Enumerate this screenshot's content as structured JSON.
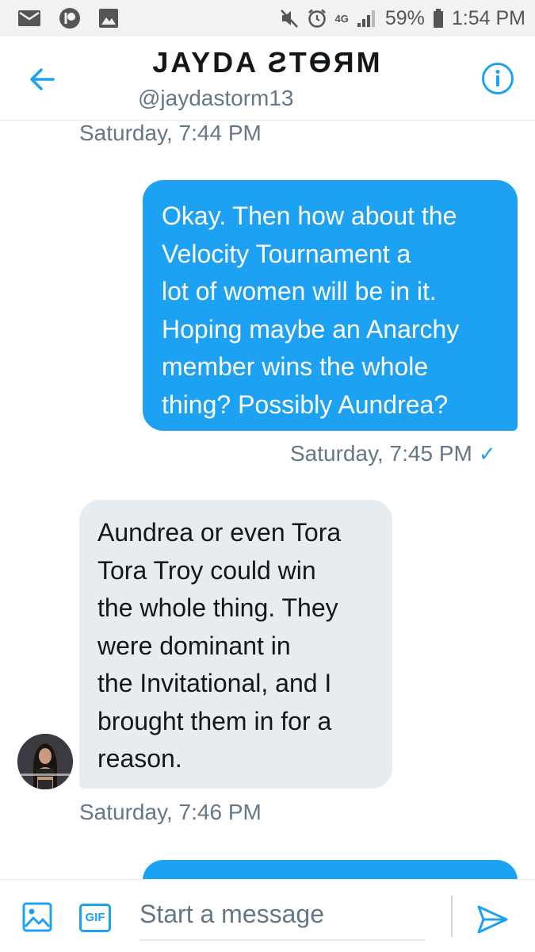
{
  "status_bar": {
    "battery": "59%",
    "time": "1:54 PM",
    "network": "4G"
  },
  "header": {
    "title": "JAYDA ƧTӨЯM",
    "handle": "@jaydastorm13"
  },
  "colors": {
    "accent": "#1da1f2",
    "incoming_bubble": "#e6ecf0",
    "secondary_text": "#657786"
  },
  "conversation": {
    "timestamp_1": "Saturday, 7:44 PM",
    "outgoing_1": {
      "lines": [
        "Okay. Then how about the",
        "Velocity Tournament a",
        "lot of women will be in it.",
        "Hoping maybe an Anarchy",
        "member wins the whole",
        "thing? Possibly Aundrea?"
      ],
      "timestamp": "Saturday, 7:45 PM",
      "status_glyph": "✓"
    },
    "incoming_1": {
      "lines": [
        "Aundrea or even Tora",
        "Tora Troy could win",
        "the whole thing. They",
        "were dominant in",
        "the Invitational, and I",
        "brought them in for a",
        "reason."
      ],
      "timestamp": "Saturday, 7:46 PM"
    }
  },
  "composer": {
    "placeholder": "Start a message",
    "gif_label": "GIF"
  },
  "icons": {
    "back": "back-arrow-icon",
    "info": "info-icon",
    "image": "image-icon",
    "send": "send-icon"
  }
}
